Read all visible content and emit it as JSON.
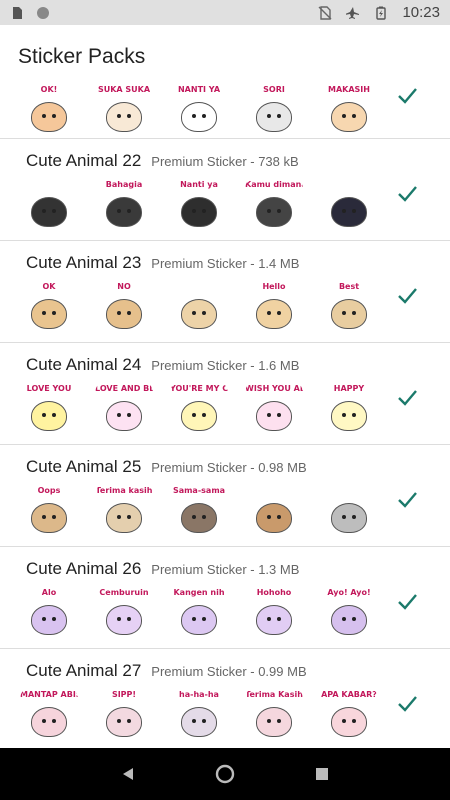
{
  "status": {
    "time": "10:23"
  },
  "app": {
    "title": "Sticker Packs"
  },
  "first_pack": {
    "labels": [
      "OK!",
      "SUKA SUKA",
      "NANTI YA",
      "SORI",
      "MAKASIH"
    ],
    "colors": [
      "#f5c79a",
      "#f8e9d6",
      "#ffffff",
      "#e8e8e8",
      "#f7d7b0"
    ]
  },
  "packs": [
    {
      "name": "Cute Animal 22",
      "meta": "Premium Sticker - 738 kB",
      "labels": [
        "",
        "Bahagia",
        "Nanti ya",
        "Kamu dimana?",
        ""
      ],
      "colors": [
        "#333333",
        "#3a3a3a",
        "#2e2e2e",
        "#444444",
        "#2a2a3a"
      ]
    },
    {
      "name": "Cute Animal 23",
      "meta": "Premium Sticker - 1.4 MB",
      "labels": [
        "OK",
        "NO",
        "",
        "Hello",
        "Best"
      ],
      "colors": [
        "#e9c48f",
        "#e6c08c",
        "#edd3a8",
        "#f0d2a2",
        "#e8cda0"
      ]
    },
    {
      "name": "Cute Animal 24",
      "meta": "Premium Sticker - 1.6 MB",
      "labels": [
        "LOVE YOU",
        "LOVE AND BLESS YOU",
        "YOU'RE MY CINDERELLA",
        "WISH YOU ALL",
        "HAPPY"
      ],
      "colors": [
        "#fff3a0",
        "#fde2f2",
        "#fff6b8",
        "#fde0ef",
        "#fff8c4"
      ]
    },
    {
      "name": "Cute Animal 25",
      "meta": "Premium Sticker - 0.98 MB",
      "labels": [
        "Oops",
        "Terima kasih",
        "Sama-sama",
        "",
        ""
      ],
      "colors": [
        "#dcb88a",
        "#e4cfae",
        "#8a7666",
        "#c99a6b",
        "#bdbdbd"
      ]
    },
    {
      "name": "Cute Animal 26",
      "meta": "Premium Sticker - 1.3 MB",
      "labels": [
        "Alo",
        "Cemburuin",
        "Kangen nih",
        "Hohoho",
        "Ayo! Ayo!"
      ],
      "colors": [
        "#d9c3f0",
        "#e6d1f5",
        "#dcc8f2",
        "#e1cdf4",
        "#d6c0ee"
      ]
    },
    {
      "name": "Cute Animal 27",
      "meta": "Premium Sticker - 0.99 MB",
      "labels": [
        "MANTAP ABIS!",
        "SIPP!",
        "ha-ha-ha",
        "Terima Kasih",
        "APA KABAR?"
      ],
      "colors": [
        "#f6d4dc",
        "#f3d9e0",
        "#e4dbe8",
        "#f5d7de",
        "#f8d6dc"
      ]
    }
  ]
}
